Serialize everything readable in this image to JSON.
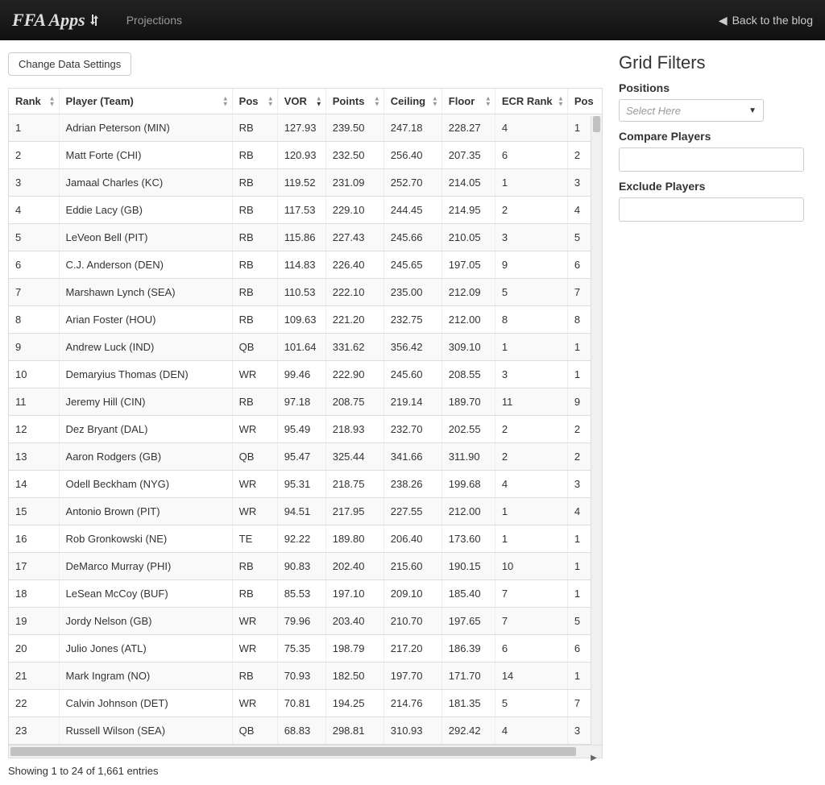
{
  "navbar": {
    "brand": "FFA Apps",
    "link_projections": "Projections",
    "back_label": "Back to the blog"
  },
  "toolbar": {
    "change_settings": "Change Data Settings"
  },
  "table": {
    "headers": {
      "rank": "Rank",
      "player": "Player (Team)",
      "pos": "Pos",
      "vor": "VOR",
      "points": "Points",
      "ceiling": "Ceiling",
      "floor": "Floor",
      "ecr": "ECR Rank",
      "posrank": "Pos"
    },
    "rows": [
      {
        "rank": "1",
        "player": "Adrian Peterson (MIN)",
        "pos": "RB",
        "vor": "127.93",
        "points": "239.50",
        "ceiling": "247.18",
        "floor": "228.27",
        "ecr": "4",
        "posrank": "1"
      },
      {
        "rank": "2",
        "player": "Matt Forte (CHI)",
        "pos": "RB",
        "vor": "120.93",
        "points": "232.50",
        "ceiling": "256.40",
        "floor": "207.35",
        "ecr": "6",
        "posrank": "2"
      },
      {
        "rank": "3",
        "player": "Jamaal Charles (KC)",
        "pos": "RB",
        "vor": "119.52",
        "points": "231.09",
        "ceiling": "252.70",
        "floor": "214.05",
        "ecr": "1",
        "posrank": "3"
      },
      {
        "rank": "4",
        "player": "Eddie Lacy (GB)",
        "pos": "RB",
        "vor": "117.53",
        "points": "229.10",
        "ceiling": "244.45",
        "floor": "214.95",
        "ecr": "2",
        "posrank": "4"
      },
      {
        "rank": "5",
        "player": "LeVeon Bell (PIT)",
        "pos": "RB",
        "vor": "115.86",
        "points": "227.43",
        "ceiling": "245.66",
        "floor": "210.05",
        "ecr": "3",
        "posrank": "5"
      },
      {
        "rank": "6",
        "player": "C.J. Anderson (DEN)",
        "pos": "RB",
        "vor": "114.83",
        "points": "226.40",
        "ceiling": "245.65",
        "floor": "197.05",
        "ecr": "9",
        "posrank": "6"
      },
      {
        "rank": "7",
        "player": "Marshawn Lynch (SEA)",
        "pos": "RB",
        "vor": "110.53",
        "points": "222.10",
        "ceiling": "235.00",
        "floor": "212.09",
        "ecr": "5",
        "posrank": "7"
      },
      {
        "rank": "8",
        "player": "Arian Foster (HOU)",
        "pos": "RB",
        "vor": "109.63",
        "points": "221.20",
        "ceiling": "232.75",
        "floor": "212.00",
        "ecr": "8",
        "posrank": "8"
      },
      {
        "rank": "9",
        "player": "Andrew Luck (IND)",
        "pos": "QB",
        "vor": "101.64",
        "points": "331.62",
        "ceiling": "356.42",
        "floor": "309.10",
        "ecr": "1",
        "posrank": "1"
      },
      {
        "rank": "10",
        "player": "Demaryius Thomas (DEN)",
        "pos": "WR",
        "vor": "99.46",
        "points": "222.90",
        "ceiling": "245.60",
        "floor": "208.55",
        "ecr": "3",
        "posrank": "1"
      },
      {
        "rank": "11",
        "player": "Jeremy Hill (CIN)",
        "pos": "RB",
        "vor": "97.18",
        "points": "208.75",
        "ceiling": "219.14",
        "floor": "189.70",
        "ecr": "11",
        "posrank": "9"
      },
      {
        "rank": "12",
        "player": "Dez Bryant (DAL)",
        "pos": "WR",
        "vor": "95.49",
        "points": "218.93",
        "ceiling": "232.70",
        "floor": "202.55",
        "ecr": "2",
        "posrank": "2"
      },
      {
        "rank": "13",
        "player": "Aaron Rodgers (GB)",
        "pos": "QB",
        "vor": "95.47",
        "points": "325.44",
        "ceiling": "341.66",
        "floor": "311.90",
        "ecr": "2",
        "posrank": "2"
      },
      {
        "rank": "14",
        "player": "Odell Beckham (NYG)",
        "pos": "WR",
        "vor": "95.31",
        "points": "218.75",
        "ceiling": "238.26",
        "floor": "199.68",
        "ecr": "4",
        "posrank": "3"
      },
      {
        "rank": "15",
        "player": "Antonio Brown (PIT)",
        "pos": "WR",
        "vor": "94.51",
        "points": "217.95",
        "ceiling": "227.55",
        "floor": "212.00",
        "ecr": "1",
        "posrank": "4"
      },
      {
        "rank": "16",
        "player": "Rob Gronkowski (NE)",
        "pos": "TE",
        "vor": "92.22",
        "points": "189.80",
        "ceiling": "206.40",
        "floor": "173.60",
        "ecr": "1",
        "posrank": "1"
      },
      {
        "rank": "17",
        "player": "DeMarco Murray (PHI)",
        "pos": "RB",
        "vor": "90.83",
        "points": "202.40",
        "ceiling": "215.60",
        "floor": "190.15",
        "ecr": "10",
        "posrank": "1"
      },
      {
        "rank": "18",
        "player": "LeSean McCoy (BUF)",
        "pos": "RB",
        "vor": "85.53",
        "points": "197.10",
        "ceiling": "209.10",
        "floor": "185.40",
        "ecr": "7",
        "posrank": "1"
      },
      {
        "rank": "19",
        "player": "Jordy Nelson (GB)",
        "pos": "WR",
        "vor": "79.96",
        "points": "203.40",
        "ceiling": "210.70",
        "floor": "197.65",
        "ecr": "7",
        "posrank": "5"
      },
      {
        "rank": "20",
        "player": "Julio Jones (ATL)",
        "pos": "WR",
        "vor": "75.35",
        "points": "198.79",
        "ceiling": "217.20",
        "floor": "186.39",
        "ecr": "6",
        "posrank": "6"
      },
      {
        "rank": "21",
        "player": "Mark Ingram (NO)",
        "pos": "RB",
        "vor": "70.93",
        "points": "182.50",
        "ceiling": "197.70",
        "floor": "171.70",
        "ecr": "14",
        "posrank": "1"
      },
      {
        "rank": "22",
        "player": "Calvin Johnson (DET)",
        "pos": "WR",
        "vor": "70.81",
        "points": "194.25",
        "ceiling": "214.76",
        "floor": "181.35",
        "ecr": "5",
        "posrank": "7"
      },
      {
        "rank": "23",
        "player": "Russell Wilson (SEA)",
        "pos": "QB",
        "vor": "68.83",
        "points": "298.81",
        "ceiling": "310.93",
        "floor": "292.42",
        "ecr": "4",
        "posrank": "3"
      }
    ],
    "info": "Showing 1 to 24 of 1,661 entries"
  },
  "filters": {
    "title": "Grid Filters",
    "positions_label": "Positions",
    "positions_placeholder": "Select Here",
    "compare_label": "Compare Players",
    "exclude_label": "Exclude Players"
  }
}
